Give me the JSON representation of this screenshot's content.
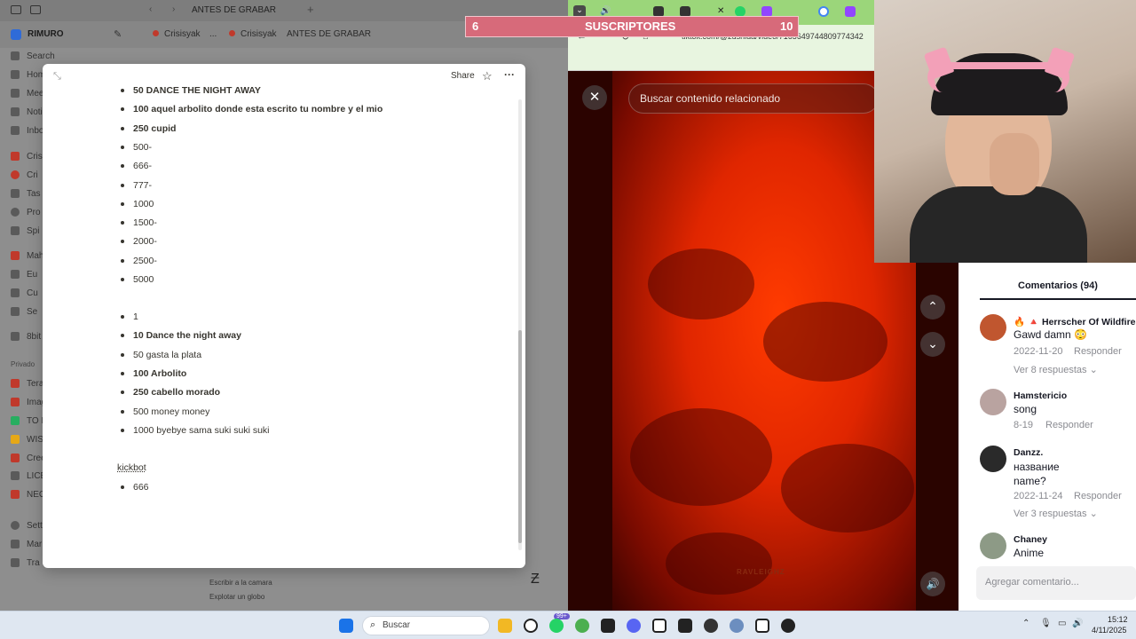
{
  "notion": {
    "page_tab": "ANTES DE GRABAR",
    "workspace": "RIMURO",
    "breadcrumb": [
      "Crisisyak",
      "...",
      "Crisisyak",
      "ANTES DE GRABAR"
    ],
    "sidebar": [
      "Search",
      "Hom",
      "Mee",
      "Noti",
      "Inbo",
      "Cris",
      "Cri",
      "Tas",
      "Pro",
      "Spi",
      "Mah",
      "Eu",
      "Cu",
      "Se",
      "8bit",
      "Privado",
      "Tera",
      "Imag",
      "TO D",
      "WIS",
      "Cree",
      "LICE",
      "NEG",
      "Sett",
      "Mar",
      "Tra"
    ],
    "bg_doc_lines": [
      "Escribir a la camara",
      "Explotar un globo"
    ],
    "modal": {
      "share_label": "Share",
      "items_a": [
        {
          "text": "50 DANCE THE NIGHT AWAY",
          "bold": true
        },
        {
          "text": "100 aquel arbolito donde esta escrito tu nombre y el mio",
          "bold": true
        },
        {
          "text": "250 cupid",
          "bold": true
        },
        {
          "text": "500-",
          "bold": false
        },
        {
          "text": "666-",
          "bold": false
        },
        {
          "text": "777-",
          "bold": false
        },
        {
          "text": "1000",
          "bold": false
        },
        {
          "text": "1500-",
          "bold": false
        },
        {
          "text": "2000-",
          "bold": false
        },
        {
          "text": "2500-",
          "bold": false
        },
        {
          "text": "5000",
          "bold": false
        }
      ],
      "items_b": [
        {
          "text": "1",
          "bold": false
        },
        {
          "text": "10 Dance the night away",
          "bold": true
        },
        {
          "text": "50 gasta la plata",
          "bold": false
        },
        {
          "text": "100 Arbolito",
          "bold": true
        },
        {
          "text": "250 cabello morado",
          "bold": true
        },
        {
          "text": "500 money money",
          "bold": false
        },
        {
          "text": "1000 byebye sama suki suki suki",
          "bold": false
        }
      ],
      "heading": "kickbot",
      "items_c": [
        {
          "text": "666",
          "bold": false
        }
      ]
    }
  },
  "browser": {
    "url": "tiktok.com/@zushida/video/7165649744809774342",
    "search_placeholder": "Buscar contenido relacionado",
    "watermark": "RAVLEIGHZ"
  },
  "overlay": {
    "left_count": "6",
    "label": "SUSCRIPTORES",
    "right_count": "10"
  },
  "comments": {
    "header": "Comentarios (94)",
    "reply_label": "Responder",
    "items": [
      {
        "user": "🔥 🔺 Herrscher Of Wildfire",
        "text": "Gawd damn 😳",
        "date": "2022-11-20",
        "replies": "Ver 8 respuestas"
      },
      {
        "user": "Hamstericio",
        "text": "song",
        "date": "8-19",
        "replies": ""
      },
      {
        "user": "Danzz.",
        "text": "название name?",
        "date": "2022-11-24",
        "replies": "Ver 3 respuestas"
      },
      {
        "user": "Chaney",
        "text": "Anime",
        "date": "",
        "replies": ""
      }
    ],
    "add_placeholder": "Agregar comentario..."
  },
  "taskbar": {
    "search_label": "Buscar",
    "badge": "99+",
    "time": "15:12",
    "date": "4/11/2025"
  },
  "colors": {
    "video_red": "#e02600",
    "overlay_pink": "#d76a7a",
    "browser_green": "#9bd67a"
  }
}
